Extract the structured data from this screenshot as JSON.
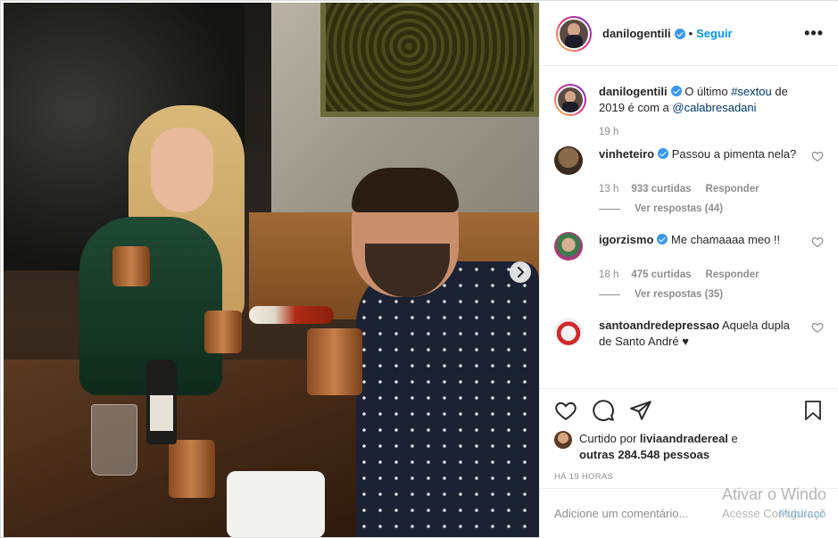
{
  "post": {
    "username": "danilogentili",
    "follow_label": "Seguir",
    "more_label": "•••",
    "separator": "•"
  },
  "caption": {
    "username": "danilogentili",
    "text_before": "O último ",
    "hashtag": "#sextou",
    "text_mid": " de 2019 é com a ",
    "mention": "@calabresadani",
    "time": "19 h"
  },
  "comments": [
    {
      "username": "vinheteiro",
      "verified": true,
      "text": "Passou a pimenta nela?",
      "time": "13 h",
      "likes": "933 curtidas",
      "reply_label": "Responder",
      "view_replies": "Ver respostas (44)"
    },
    {
      "username": "igorzismo",
      "verified": true,
      "text": "Me chamaaaa meo !!",
      "time": "18 h",
      "likes": "475 curtidas",
      "reply_label": "Responder",
      "view_replies": "Ver respostas (35)"
    },
    {
      "username": "santoandredepressao",
      "verified": false,
      "text": "Aquela dupla de Santo André ♥"
    }
  ],
  "likes": {
    "prefix": "Curtido por ",
    "liker": "liviaandradereal",
    "mid": " e",
    "others": "outras 284.548 pessoas"
  },
  "posted_ago": "HÁ 19 HORAS",
  "add_comment": {
    "placeholder": "Adicione um comentário...",
    "publish_label": "Publicar"
  },
  "windows_watermark": {
    "line1": "Ativar o Windo",
    "line2": "Acesse Configuraçõ"
  },
  "colors": {
    "accent": "#0095f6",
    "verified": "#3897f0",
    "muted": "#8e8e8e",
    "text": "#262626"
  }
}
